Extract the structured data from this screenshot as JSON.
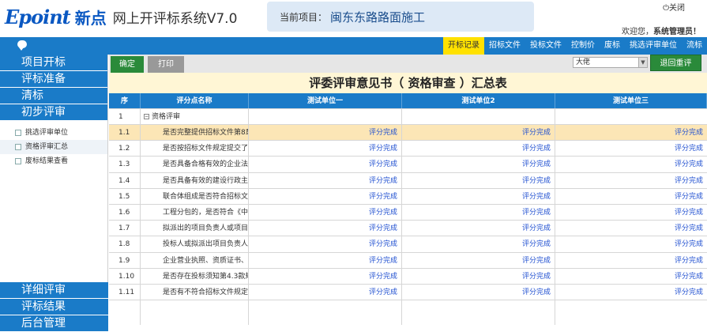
{
  "header": {
    "brand": "Epoint",
    "brand_cn": "新点",
    "system_name": "网上开评标系统V7.0",
    "project_label": "当前项目：",
    "project_name": "闽东东路路面施工",
    "close_label": "关闭",
    "welcome_prefix": "欢迎您，",
    "user_name": "系统管理员！"
  },
  "nav": {
    "tabs": [
      "开标记录",
      "招标文件",
      "投标文件",
      "控制价",
      "废标",
      "挑选评审单位",
      "流标"
    ],
    "active_index": 0
  },
  "sidebar": {
    "top_sections": [
      "项目开标",
      "评标准备",
      "清标",
      "初步评审"
    ],
    "sub_items": [
      "挑选评审单位",
      "资格评审汇总",
      "废标结果查看"
    ],
    "selected_sub_index": 1,
    "bottom_sections": [
      "详细评审",
      "评标结果",
      "后台管理"
    ]
  },
  "toolbar": {
    "confirm_label": "确定",
    "print_label": "打印",
    "ratio_value": "大佬",
    "back_label": "退回重评"
  },
  "report": {
    "title": "评委评审意见书（ 资格审查 ）汇总表",
    "columns": [
      "序",
      "评分点名称",
      "测试单位一",
      "测试单位2",
      "测试单位三"
    ],
    "section_no": "1",
    "section_label": "资格评审",
    "rows": [
      {
        "no": "1.1",
        "name": "是否完整提供招标文件第8章",
        "v1": "评分完成",
        "v2": "评分完成",
        "v3": "评分完成",
        "highlight": true
      },
      {
        "no": "1.2",
        "name": "是否按招标文件规定提交了投标",
        "v1": "评分完成",
        "v2": "评分完成",
        "v3": "评分完成"
      },
      {
        "no": "1.3",
        "name": "是否具备合格有效的企业法人营",
        "v1": "评分完成",
        "v2": "评分完成",
        "v3": "评分完成"
      },
      {
        "no": "1.4",
        "name": "是否具备有效的建设行政主管部",
        "v1": "评分完成",
        "v2": "评分完成",
        "v3": "评分完成"
      },
      {
        "no": "1.5",
        "name": "联合体组成是否符合招标文件规",
        "v1": "评分完成",
        "v2": "评分完成",
        "v3": "评分完成"
      },
      {
        "no": "1.6",
        "name": "工程分包的，是否符合《中华人",
        "v1": "评分完成",
        "v2": "评分完成",
        "v3": "评分完成"
      },
      {
        "no": "1.7",
        "name": "拟派出的项目负责人或项目技术",
        "v1": "评分完成",
        "v2": "评分完成",
        "v3": "评分完成"
      },
      {
        "no": "1.8",
        "name": "投标人或拟派出项目负责人的",
        "v1": "评分完成",
        "v2": "评分完成",
        "v3": "评分完成"
      },
      {
        "no": "1.9",
        "name": "企业营业执照、资质证书、安全",
        "v1": "评分完成",
        "v2": "评分完成",
        "v3": "评分完成"
      },
      {
        "no": "1.10",
        "name": "是否存在投标须知第4.3款规定",
        "v1": "评分完成",
        "v2": "评分完成",
        "v3": "评分完成"
      },
      {
        "no": "1.11",
        "name": "是否有不符合招标文件规定的重",
        "v1": "评分完成",
        "v2": "评分完成",
        "v3": "评分完成"
      }
    ]
  },
  "colors": {
    "primary_blue": "#1a7bc8",
    "nav_active": "#ffe100",
    "confirm_green": "#2a8a3a",
    "link_blue": "#1f4fd0",
    "highlight_row": "#fce6b6",
    "title_bg": "#fff6d5"
  },
  "icons": {
    "chat": "chat-bubble-icon",
    "power": "power-icon",
    "collapse": "minus-square-icon"
  }
}
